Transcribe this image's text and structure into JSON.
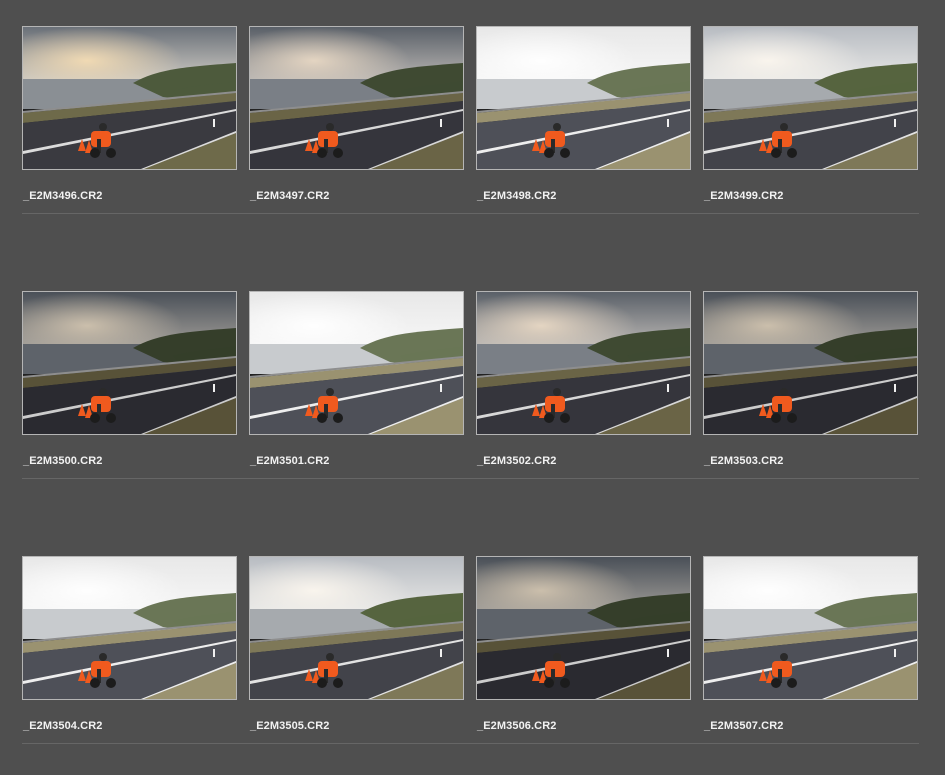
{
  "browser": {
    "rows": [
      {
        "items": [
          {
            "filename": "_E2M3496.CR2",
            "exposure": "warm"
          },
          {
            "filename": "_E2M3497.CR2",
            "exposure": "normal"
          },
          {
            "filename": "_E2M3498.CR2",
            "exposure": "bright"
          },
          {
            "filename": "_E2M3499.CR2",
            "exposure": "light"
          }
        ]
      },
      {
        "items": [
          {
            "filename": "_E2M3500.CR2",
            "exposure": "dark"
          },
          {
            "filename": "_E2M3501.CR2",
            "exposure": "bright"
          },
          {
            "filename": "_E2M3502.CR2",
            "exposure": "normal"
          },
          {
            "filename": "_E2M3503.CR2",
            "exposure": "dark"
          }
        ]
      },
      {
        "items": [
          {
            "filename": "_E2M3504.CR2",
            "exposure": "bright"
          },
          {
            "filename": "_E2M3505.CR2",
            "exposure": "light"
          },
          {
            "filename": "_E2M3506.CR2",
            "exposure": "dark"
          },
          {
            "filename": "_E2M3507.CR2",
            "exposure": "bright"
          }
        ]
      }
    ]
  },
  "colors": {
    "background": "#4f4f4f",
    "thumbnail_border": "#b5b5b5",
    "filename_text": "#f2f2f2",
    "divider": "#666666",
    "cone_orange": "#f05a1e"
  }
}
